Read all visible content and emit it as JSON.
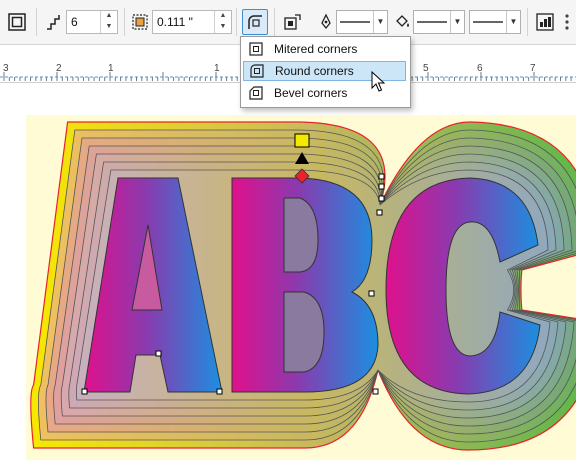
{
  "toolbar": {
    "steps_value": "6",
    "offset_value": "0.111 \"",
    "fill_color": "#e8232b",
    "outline_color": "#f4ea00",
    "end_color": "#58b847"
  },
  "corner_menu": {
    "items": [
      {
        "label": "Mitered corners"
      },
      {
        "label": "Round corners"
      },
      {
        "label": "Bevel corners"
      }
    ]
  },
  "ruler": {
    "labels": [
      "3",
      "2",
      "1",
      "1",
      "5",
      "6",
      "7"
    ]
  },
  "artwork": {
    "text": "ABC",
    "gradient_colors": [
      "#e0108c",
      "#7f3fb0",
      "#1b8fe0"
    ],
    "contour_colors": [
      "#f8e800",
      "#58b847"
    ],
    "page_color": "#fffbd4"
  }
}
